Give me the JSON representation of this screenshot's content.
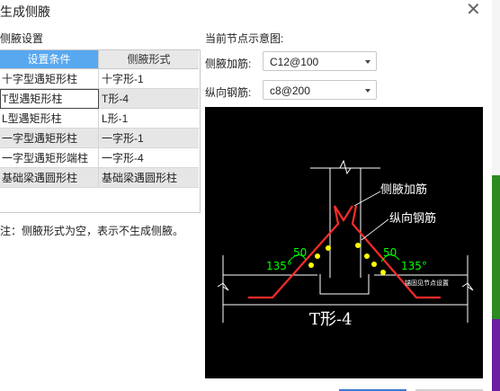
{
  "window": {
    "title": "生成侧腋"
  },
  "left_section_label": "侧腋设置",
  "right_section_label": "当前节点示意图:",
  "table": {
    "headers": [
      "设置条件",
      "侧腋形式"
    ],
    "rows": [
      [
        "十字型遇矩形柱",
        "十字形-1"
      ],
      [
        "T型遇矩形柱",
        "T形-4"
      ],
      [
        "L型遇矩形柱",
        "L形-1"
      ],
      [
        "一字型遇矩形柱",
        "一字形-1"
      ],
      [
        "一字型遇矩形端柱",
        "一字形-4"
      ],
      [
        "基础梁遇圆形柱",
        "基础梁遇圆形柱"
      ]
    ]
  },
  "note": "注：侧腋形式为空，表示不生成侧腋。",
  "fields": {
    "side_bar": {
      "label": "侧腋加筋:",
      "value": "C12@100"
    },
    "long_bar": {
      "label": "纵向钢筋:",
      "value": "c8@200"
    }
  },
  "diagram": {
    "label_side_bar": "侧腋加筋",
    "label_long_bar": "纵向钢筋",
    "dim_left": "50",
    "dim_right": "50",
    "angle_left": "135°",
    "angle_right": "135°",
    "anchor_note": "锚固见节点设置",
    "caption": "T形-4",
    "colors": {
      "rebar": "#ff2a2a",
      "dot": "#ffff00",
      "dim": "#00ff00",
      "line": "#ffffff"
    }
  }
}
